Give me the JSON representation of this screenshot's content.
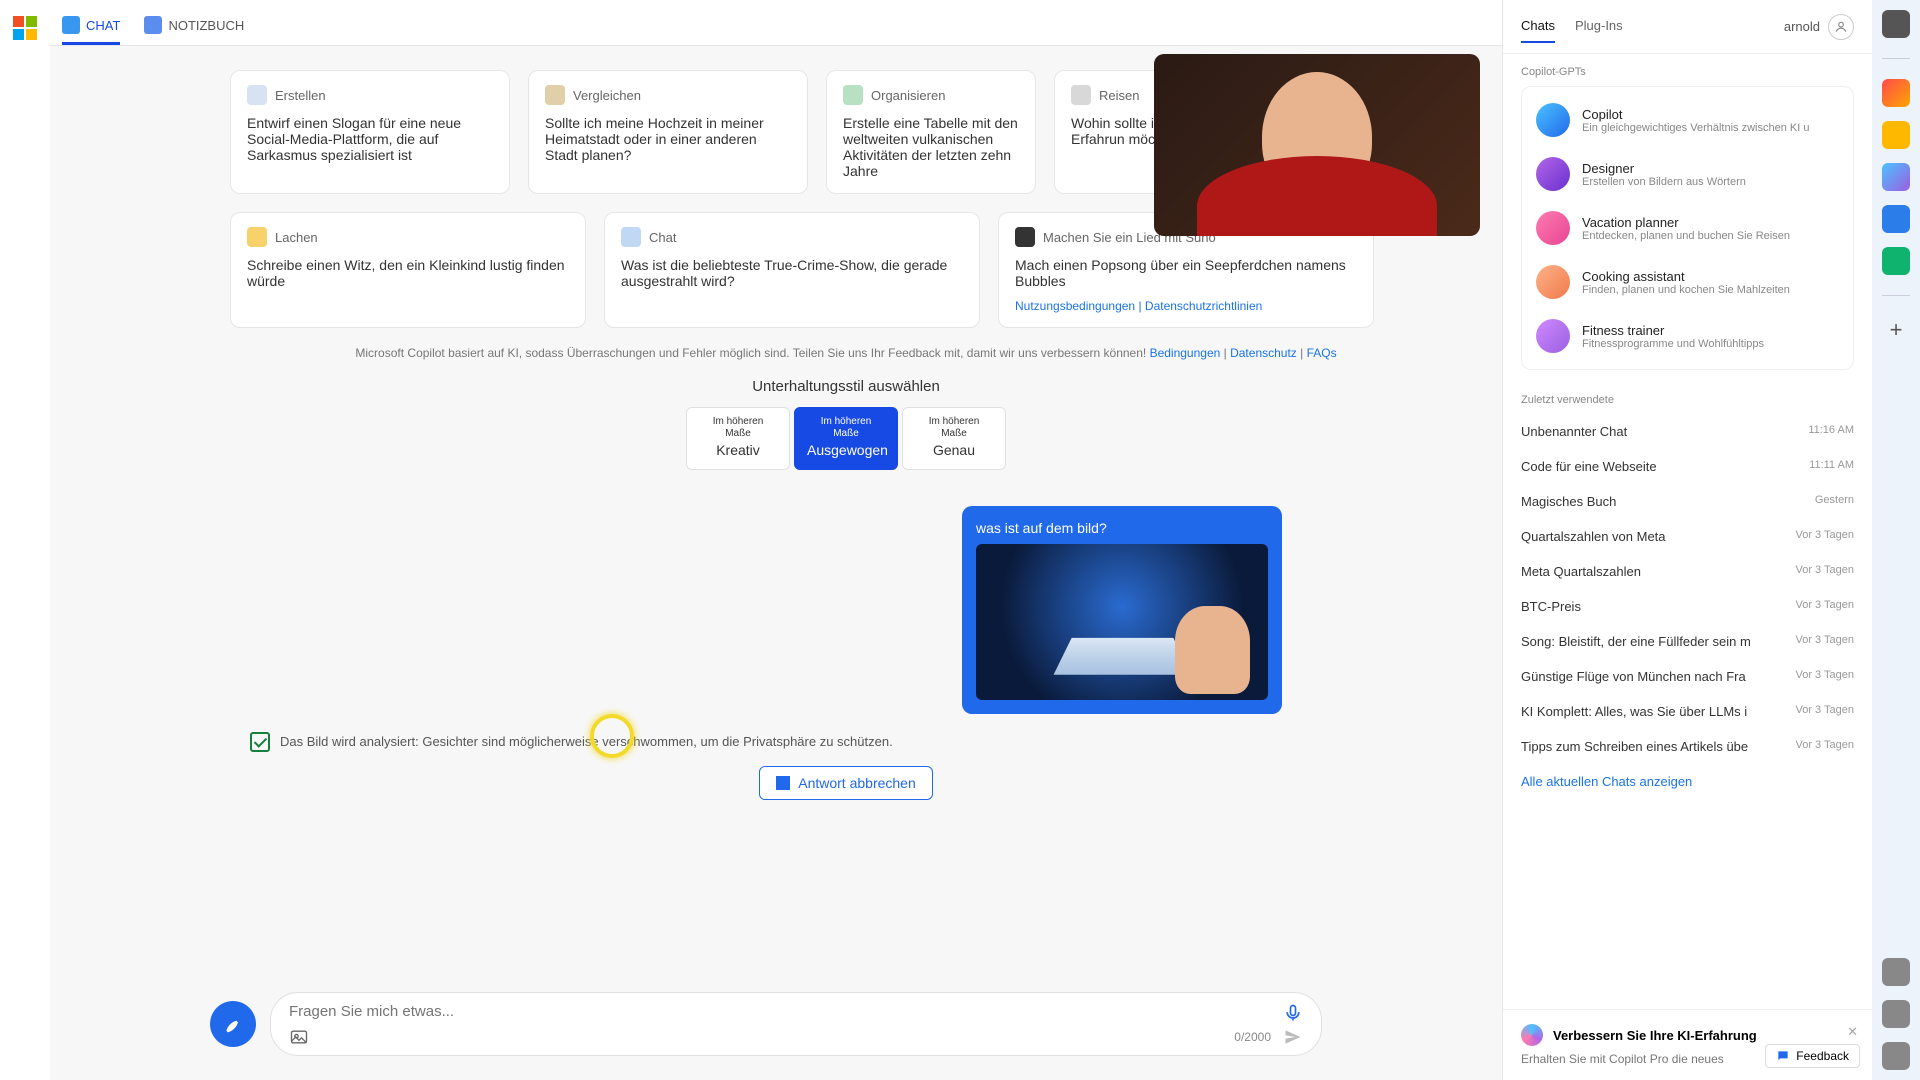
{
  "tabs_top": {
    "chat": "CHAT",
    "notebook": "NOTIZBUCH"
  },
  "cards1": [
    {
      "icon": "#d7e2f3",
      "title": "Erstellen",
      "body": "Entwirf einen Slogan für eine neue Social-Media-Plattform, die auf Sarkasmus spezialisiert ist"
    },
    {
      "icon": "#e0cfa8",
      "title": "Vergleichen",
      "body": "Sollte ich meine Hochzeit in meiner Heimatstadt oder in einer anderen Stadt planen?"
    },
    {
      "icon": "#b8e0c2",
      "title": "Organisieren",
      "body": "Erstelle eine Tabelle mit den weltweiten vulkanischen Aktivitäten der letzten zehn Jahre"
    },
    {
      "icon": "#d8d8d8",
      "title": "Reisen",
      "body": "Wohin sollte ich reisen, eine spirituelle Erfahrun möchte?"
    }
  ],
  "cards2": [
    {
      "icon": "#f7d26a",
      "title": "Lachen",
      "body": "Schreibe einen Witz, den ein Kleinkind lustig finden würde"
    },
    {
      "icon": "#c1d8f5",
      "title": "Chat",
      "body": "Was ist die beliebteste True-Crime-Show, die gerade ausgestrahlt wird?"
    },
    {
      "icon": "#333",
      "title": "Machen Sie ein Lied mit Suno",
      "body": "Mach einen Popsong über ein Seepferdchen namens Bubbles",
      "links": true
    }
  ],
  "card_links": {
    "terms": "Nutzungsbedingungen",
    "sep": " | ",
    "privacy": "Datenschutzrichtlinien"
  },
  "disclaimer": {
    "text": "Microsoft Copilot basiert auf KI, sodass Überraschungen und Fehler möglich sind. Teilen Sie uns Ihr Feedback mit, damit wir uns verbessern können!  ",
    "l1": "Bedingungen",
    "l2": "Datenschutz",
    "l3": "FAQs"
  },
  "style": {
    "title": "Unterhaltungsstil auswählen",
    "pre": "Im höheren Maße",
    "o1": "Kreativ",
    "o2": "Ausgewogen",
    "o3": "Genau"
  },
  "user_msg": {
    "q": "was ist auf dem bild?"
  },
  "analyze": "Das Bild wird analysiert: Gesichter sind möglicherweise verschwommen, um die Privatsphäre zu schützen.",
  "stop": "Antwort abbrechen",
  "input": {
    "placeholder": "Fragen Sie mich etwas...",
    "counter": "0/2000"
  },
  "rp": {
    "tab1": "Chats",
    "tab2": "Plug-Ins",
    "user": "arnold",
    "gpts_label": "Copilot-GPTs",
    "gpts": [
      {
        "c": "linear-gradient(135deg,#4cc2ff,#2169eb)",
        "t": "Copilot",
        "d": "Ein gleichgewichtiges Verhältnis zwischen KI u"
      },
      {
        "c": "linear-gradient(135deg,#b267e6,#6a2fd1)",
        "t": "Designer",
        "d": "Erstellen von Bildern aus Wörtern"
      },
      {
        "c": "linear-gradient(135deg,#ff7bb0,#e74694)",
        "t": "Vacation planner",
        "d": "Entdecken, planen und buchen Sie Reisen"
      },
      {
        "c": "linear-gradient(135deg,#ffb28a,#f07a4a)",
        "t": "Cooking assistant",
        "d": "Finden, planen und kochen Sie Mahlzeiten"
      },
      {
        "c": "linear-gradient(135deg,#d08aff,#9a5fe0)",
        "t": "Fitness trainer",
        "d": "Fitnessprogramme und Wohlfühltipps"
      }
    ],
    "recent_label": "Zuletzt verwendete",
    "recent": [
      {
        "n": "Unbenannter Chat",
        "t": "11:16 AM"
      },
      {
        "n": "Code für eine Webseite",
        "t": "11:11 AM"
      },
      {
        "n": "Magisches Buch",
        "t": "Gestern"
      },
      {
        "n": "Quartalszahlen von Meta",
        "t": "Vor 3 Tagen"
      },
      {
        "n": "Meta Quartalszahlen",
        "t": "Vor 3 Tagen"
      },
      {
        "n": "BTC-Preis",
        "t": "Vor 3 Tagen"
      },
      {
        "n": "Song: Bleistift, der eine Füllfeder sein m",
        "t": "Vor 3 Tagen"
      },
      {
        "n": "Günstige Flüge von München nach Fra",
        "t": "Vor 3 Tagen"
      },
      {
        "n": "KI Komplett: Alles, was Sie über LLMs i",
        "t": "Vor 3 Tagen"
      },
      {
        "n": "Tipps zum Schreiben eines Artikels übe",
        "t": "Vor 3 Tagen"
      }
    ],
    "all": "Alle aktuellen Chats anzeigen",
    "promo_t": "Verbessern Sie Ihre KI-Erfahrung",
    "promo_d": "Erhalten Sie mit Copilot Pro die neues",
    "feedback": "Feedback"
  }
}
